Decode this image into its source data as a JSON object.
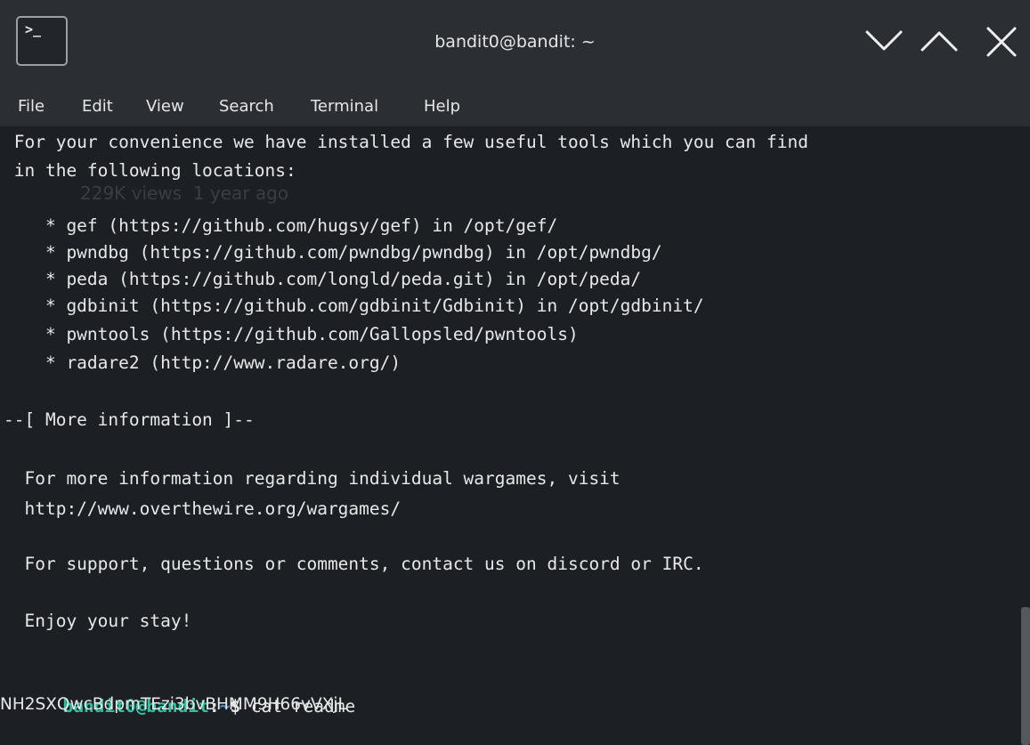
{
  "titlebar": {
    "app_icon_glyph": ">_",
    "title": "bandit0@bandit: ~",
    "buttons": [
      "minimize",
      "maximize",
      "close"
    ]
  },
  "menu": {
    "items": [
      "File",
      "Edit",
      "View",
      "Search",
      "Terminal",
      "Help"
    ]
  },
  "terminal": {
    "background_ghost": "229K views  1 year ago",
    "lines": [
      " For your convenience we have installed a few useful tools which you can find",
      " in the following locations:",
      "",
      "    * gef (https://github.com/hugsy/gef) in /opt/gef/",
      "    * pwndbg (https://github.com/pwndbg/pwndbg) in /opt/pwndbg/",
      "    * peda (https://github.com/longld/peda.git) in /opt/peda/",
      "    * gdbinit (https://github.com/gdbinit/Gdbinit) in /opt/gdbinit/",
      "    * pwntools (https://github.com/Gallopsled/pwntools)",
      "    * radare2 (http://www.radare.org/)",
      "",
      "--[ More information ]--",
      "",
      "  For more information regarding individual wargames, visit",
      "  http://www.overthewire.org/wargames/",
      "",
      "  For support, questions or comments, contact us on discord or IRC.",
      "",
      "  Enjoy your stay!"
    ],
    "prompt": {
      "user": "bandit0@bandit",
      "colon": ":",
      "path": "~",
      "symbol": "$ "
    },
    "command": "cat readme",
    "output": "NH2SXQwcBdpmTEzi3bvBHMM9H66vVXjL"
  },
  "colors": {
    "titlebar": "#2b2f33",
    "terminal_bg": "#1c1f24",
    "text": "#e8e8e8",
    "prompt_user": "#2fc0a2",
    "prompt_path": "#3b8eea"
  }
}
